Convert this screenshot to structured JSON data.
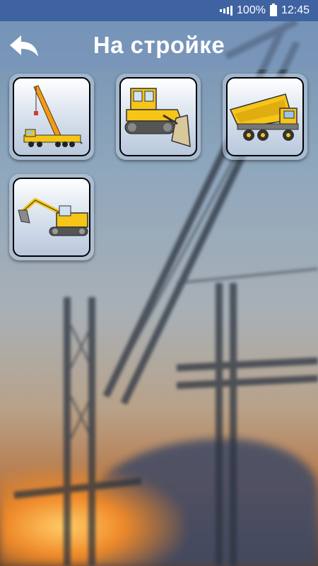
{
  "status_bar": {
    "battery_percent": "100%",
    "time": "12:45",
    "icons": [
      "signal-icon",
      "battery-icon"
    ]
  },
  "header": {
    "title": "На стройке",
    "back_icon": "back-arrow-icon"
  },
  "grid": {
    "items": [
      {
        "name": "crane-tile",
        "icon": "crane-truck-icon"
      },
      {
        "name": "bulldozer-tile",
        "icon": "bulldozer-icon"
      },
      {
        "name": "dump-truck-tile",
        "icon": "dump-truck-icon"
      },
      {
        "name": "excavator-tile",
        "icon": "excavator-icon"
      }
    ]
  },
  "colors": {
    "status_bar": "#3f63a0",
    "header_overlay": "#7896be",
    "machine_yellow": "#f5c518"
  }
}
